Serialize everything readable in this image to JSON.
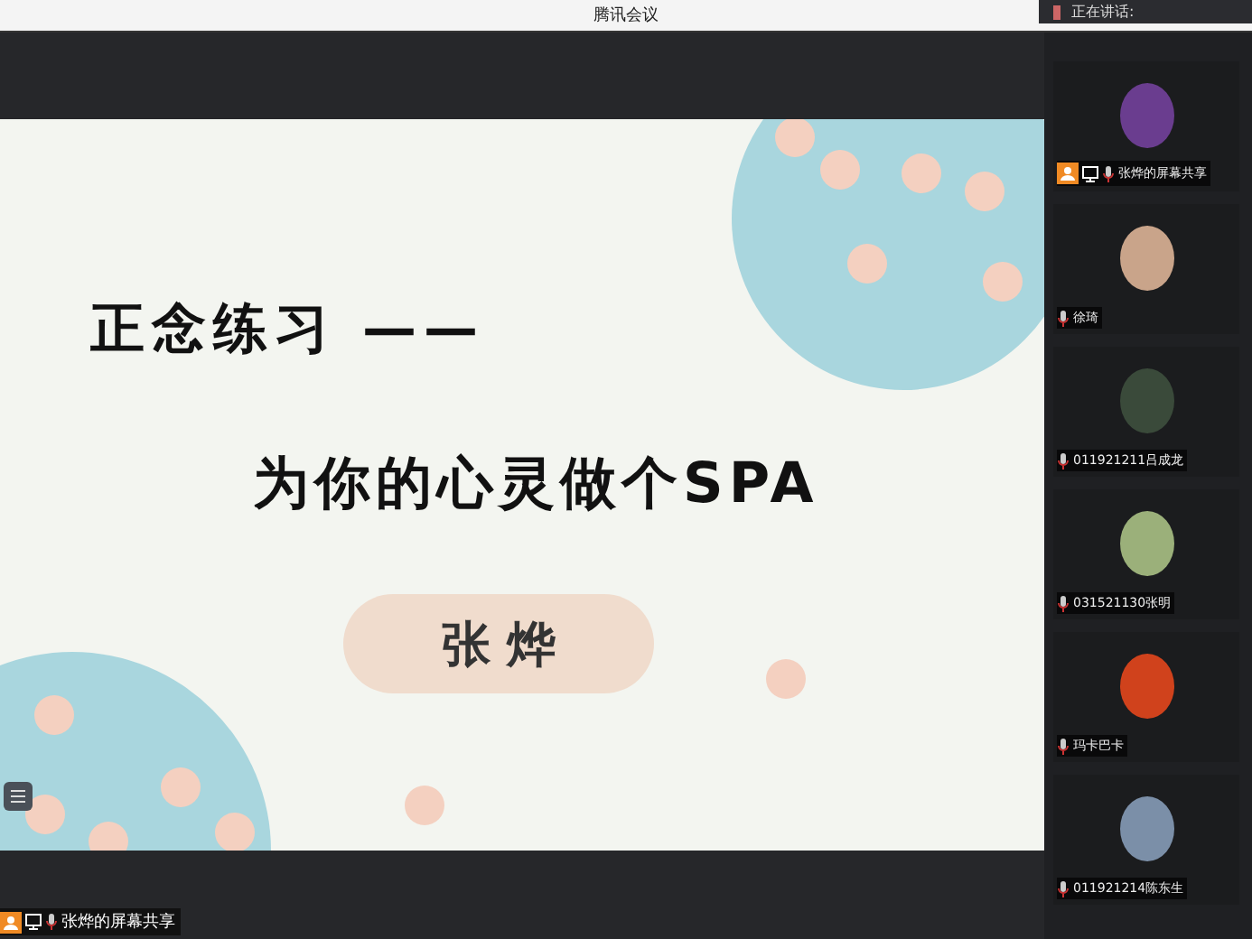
{
  "window": {
    "title": "腾讯会议"
  },
  "speaking": {
    "label": "正在讲话:"
  },
  "slide": {
    "title": "正念练习 ——",
    "subtitle": "为你的心灵做个SPA",
    "presenter": "张 烨"
  },
  "share_label": {
    "name": "张烨的屏幕共享"
  },
  "participants": [
    {
      "name": "张烨的屏幕共享",
      "sharing": true,
      "color": "#6a3d8f"
    },
    {
      "name": "徐琦",
      "sharing": false,
      "color": "#c9a48a"
    },
    {
      "name": "011921211吕成龙",
      "sharing": false,
      "color": "#3a4a3a"
    },
    {
      "name": "031521130张明",
      "sharing": false,
      "color": "#9bb07a"
    },
    {
      "name": "玛卡巴卡",
      "sharing": false,
      "color": "#d0421c"
    },
    {
      "name": "011921214陈东生",
      "sharing": false,
      "color": "#7b8fa8"
    }
  ]
}
